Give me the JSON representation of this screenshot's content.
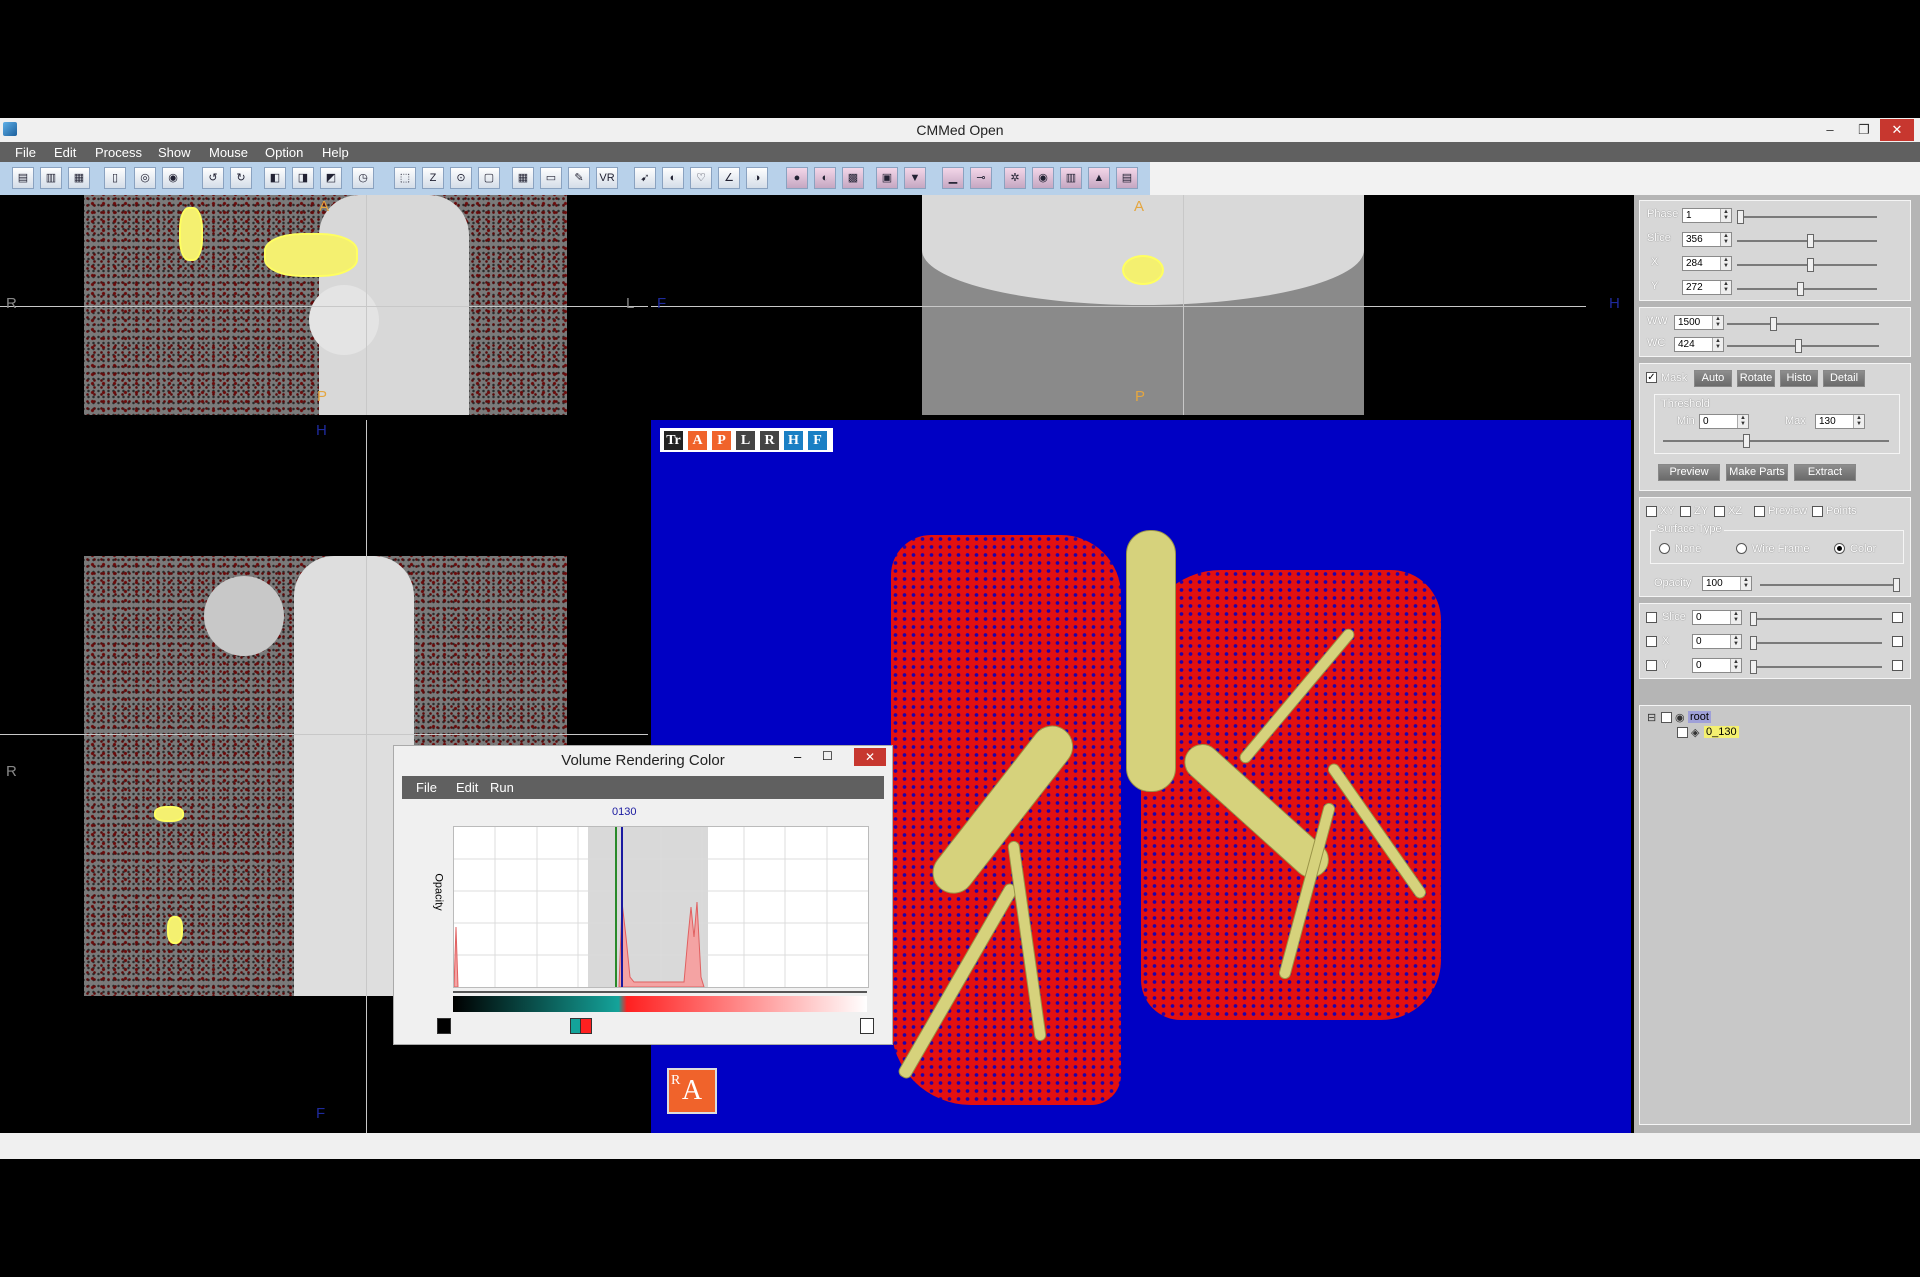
{
  "window": {
    "title": "CMMed  Open",
    "minimize": "–",
    "restore": "❐",
    "close": "✕"
  },
  "menu": [
    "File",
    "Edit",
    "Process",
    "Show",
    "Mouse",
    "Option",
    "Help"
  ],
  "toolbar_labels": {
    "zoom": "Z",
    "vr": "VR"
  },
  "views": {
    "axial": {
      "top": "A",
      "bottom": "P",
      "left": "R",
      "right": "L"
    },
    "sagittal": {
      "top": "A",
      "bottom": "P",
      "left": "F",
      "right": "H"
    },
    "coronal": {
      "top": "H",
      "bottom": "F",
      "left": "R"
    }
  },
  "vr_toolbar": [
    "Tr",
    "A",
    "P",
    "L",
    "R",
    "H",
    "F"
  ],
  "vr_orientation_cube": {
    "face1": "R",
    "face2": "A"
  },
  "panel": {
    "phase": {
      "label": "Phase",
      "value": "1",
      "slider": 0.0
    },
    "slice": {
      "label": "Slice",
      "value": "356",
      "slider": 0.52
    },
    "x": {
      "label": "X",
      "value": "284",
      "slider": 0.52
    },
    "y": {
      "label": "Y",
      "value": "272",
      "slider": 0.45
    },
    "ww": {
      "label": "WW",
      "value": "1500",
      "slider": 0.3
    },
    "wc": {
      "label": "WC",
      "value": "424",
      "slider": 0.47
    },
    "mask": {
      "label": "Mask",
      "checked": true
    },
    "buttons_row1": [
      "Auto",
      "Rotate",
      "Histo",
      "Detail"
    ],
    "threshold": {
      "group": "Threshold",
      "min_label": "Min",
      "min_value": "0",
      "max_label": "Max",
      "max_value": "130"
    },
    "buttons_row2": [
      "Preview",
      "Make Parts",
      "Extract"
    ],
    "checks_row": [
      "XY",
      "ZY",
      "XZ",
      "Preview",
      "Points"
    ],
    "surface_type": {
      "group": "Surface Type",
      "options": [
        "None",
        "Wire Frame",
        "Color"
      ],
      "selected": "Color"
    },
    "opacity": {
      "label": "Opacity",
      "value": "100",
      "slider": 1.0
    },
    "sub_slice": {
      "label": "Slice",
      "value": "0"
    },
    "sub_x": {
      "label": "X",
      "value": "0"
    },
    "sub_y": {
      "label": "Y",
      "value": "0"
    },
    "tree": {
      "root": "root",
      "child": "0_130"
    }
  },
  "dialog": {
    "title": "Volume Rendering Color",
    "menu": [
      "File",
      "Edit",
      "Run"
    ],
    "y_label": "Opacity",
    "marker_label": "0130",
    "minimize": "–",
    "restore": "☐",
    "close": "✕"
  }
}
